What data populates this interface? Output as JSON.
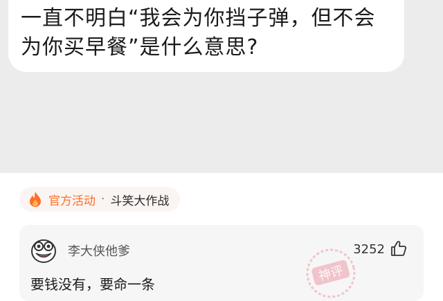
{
  "post": {
    "question": "一直不明白“我会为你挡子弹，但不会为你买早餐”是什么意思?"
  },
  "activity": {
    "tag": "官方活动",
    "separator": "·",
    "name": "斗笑大作战",
    "icon": "fire-icon",
    "accent": "#ff6e2a"
  },
  "comment": {
    "username": "李大侠他爹",
    "likes": "3252",
    "text": "要钱没有，要命一条",
    "avatar_icon": "meme-face-avatar",
    "like_icon": "thumb-up-icon",
    "stamp_text": "神评"
  }
}
